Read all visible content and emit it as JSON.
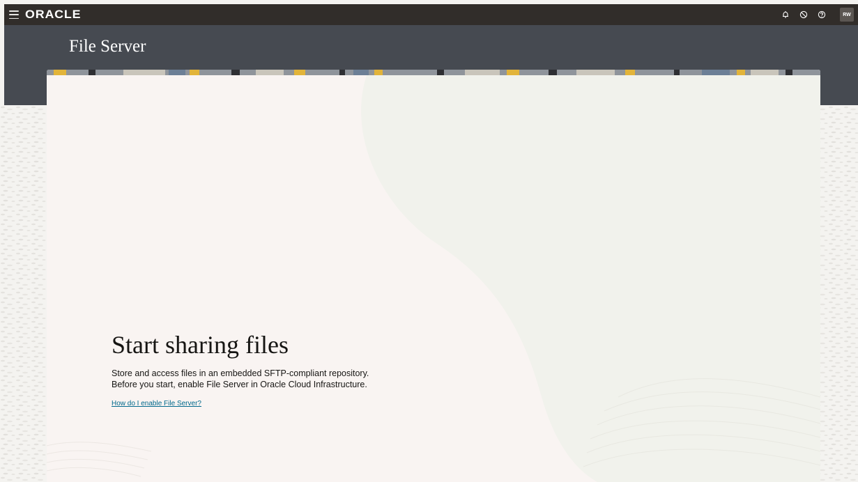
{
  "topbar": {
    "brand": "ORACLE",
    "icons": [
      "menu-icon",
      "bell-icon",
      "status-icon",
      "help-icon"
    ],
    "avatar_initials": "RW"
  },
  "header": {
    "title": "File Server"
  },
  "empty_state": {
    "title": "Start sharing files",
    "description_line1": "Store and access files in an embedded SFTP-compliant repository.",
    "description_line2": "Before you start, enable File Server in Oracle Cloud Infrastructure.",
    "link_label": "How do I enable File Server?"
  },
  "colors": {
    "topbar_bg": "#312d2a",
    "header_bg": "#464a51",
    "card_bg": "#f9f4f2",
    "link": "#00688c"
  }
}
